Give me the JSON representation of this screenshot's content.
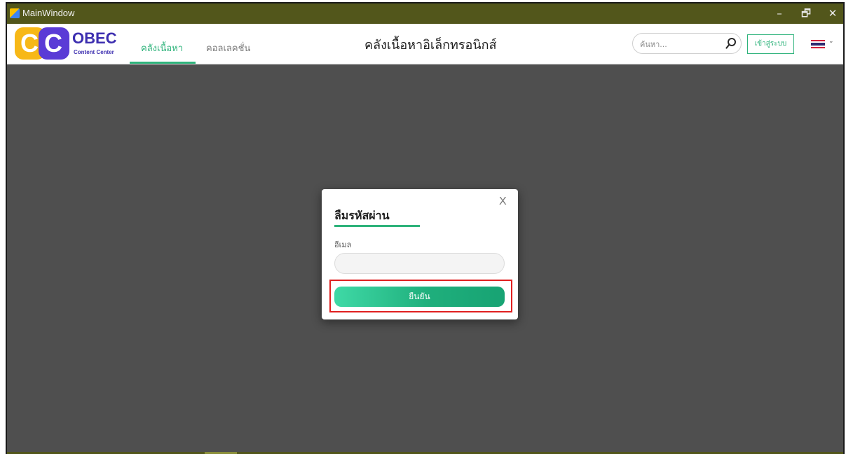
{
  "window": {
    "title": "MainWindow",
    "minimize_glyph": "–",
    "restore_glyph": "🗗",
    "close_glyph": "✕"
  },
  "header": {
    "logo": {
      "brand": "OBEC",
      "subtitle": "Content Center"
    },
    "tabs": [
      {
        "label": "คลังเนื้อหา",
        "active": true
      },
      {
        "label": "คอลเลคชั่น",
        "active": false
      }
    ],
    "page_title": "คลังเนื้อหาอิเล็กทรอนิกส์",
    "search": {
      "placeholder": "ค้นหา...",
      "icon": "search-icon"
    },
    "login_label": "เข้าสู่ระบบ",
    "language": {
      "flag": "thai-flag-icon",
      "chevron": "⌄"
    }
  },
  "modal": {
    "close_label": "X",
    "title": "ลืมรหัสผ่าน",
    "email_label": "อีเมล",
    "email_value": "",
    "confirm_label": "ยืนยัน"
  },
  "colors": {
    "accent": "#2eb37b",
    "titlebar": "#52561b",
    "overlay": "#4f4f4f",
    "highlight": "#e02020"
  }
}
